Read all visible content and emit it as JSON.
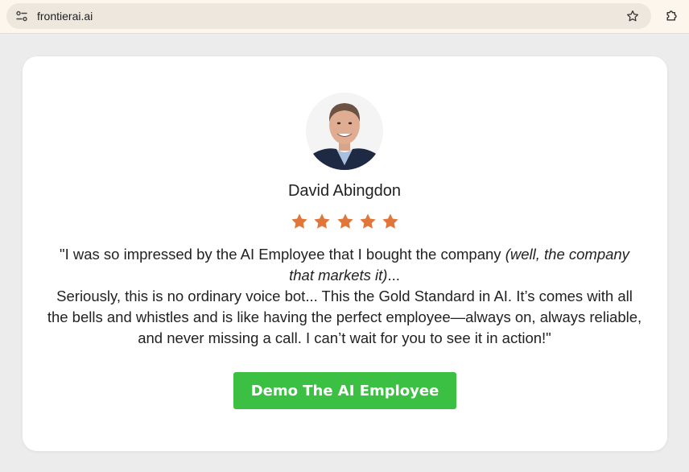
{
  "browser": {
    "url": "frontierai.ai",
    "icons": {
      "site_settings": "tune-icon",
      "bookmark": "star-outline-icon",
      "extensions": "puzzle-icon"
    }
  },
  "testimonial": {
    "name": "David Abingdon",
    "rating": 5,
    "rating_max": 5,
    "star_color": "#e0763a",
    "quote_open": "\"I was so impressed by the AI Employee that I bought the company ",
    "quote_italic": "(well, the company that markets it)",
    "quote_after_italic": "...",
    "quote_body": "Seriously, this is no ordinary voice bot... This the Gold Standard in AI. It’s comes with all the bells and whistles and is like having the perfect employee—always on, always reliable, and never missing a call. I can’t wait for you to see it in action!\""
  },
  "cta": {
    "label": "Demo The AI Employee",
    "color": "#3cc043"
  }
}
